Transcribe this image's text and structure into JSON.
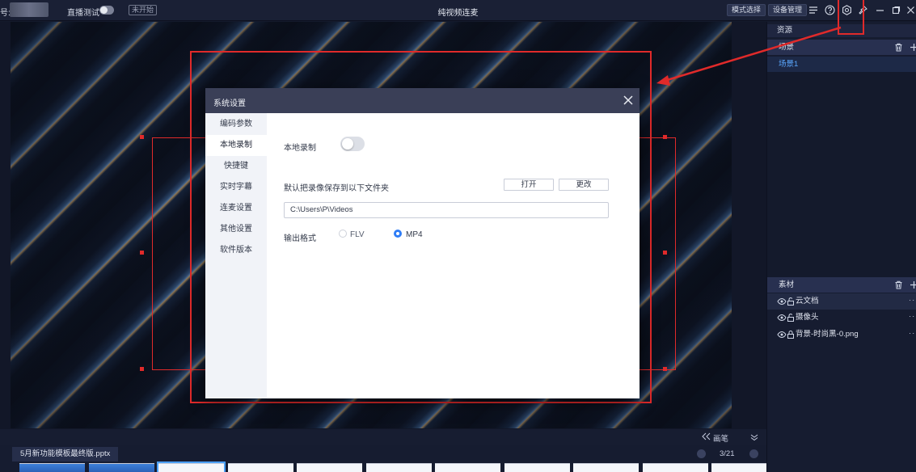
{
  "topbar": {
    "account_prefix": "号:",
    "live_test_label": "直播测试",
    "status_badge": "未开始",
    "title": "纯视频连麦",
    "mode_select_btn": "模式选择",
    "device_manage_btn": "设备管理",
    "icons": [
      "menu-icon",
      "help-icon",
      "settings-gear-icon",
      "pin-icon",
      "minimize-icon",
      "maximize-icon",
      "close-icon"
    ]
  },
  "dialog": {
    "title": "系统设置",
    "nav": [
      {
        "label": "编码参数",
        "active": false
      },
      {
        "label": "本地录制",
        "active": true
      },
      {
        "label": "快捷键",
        "active": false
      },
      {
        "label": "实时字幕",
        "active": false
      },
      {
        "label": "连麦设置",
        "active": false
      },
      {
        "label": "其他设置",
        "active": false
      },
      {
        "label": "软件版本",
        "active": false
      }
    ],
    "local_record_label": "本地录制",
    "local_record_enabled": false,
    "save_folder_label": "默认把录像保存到以下文件夹",
    "open_btn": "打开",
    "change_btn": "更改",
    "save_path": "C:\\Users\\P\\Videos",
    "format_label": "输出格式",
    "formats": [
      {
        "label": "FLV",
        "selected": false
      },
      {
        "label": "MP4",
        "selected": true
      }
    ]
  },
  "right_panel": {
    "resources_label": "资源",
    "scenes_label": "场景",
    "scenes": [
      "场景1"
    ],
    "materials_label": "素材",
    "materials": [
      {
        "name": "云文档",
        "visible": true,
        "locked": false
      },
      {
        "name": "摄像头",
        "visible": true,
        "locked": false
      },
      {
        "name": "背景-时尚黑-0.png",
        "visible": true,
        "locked": true
      }
    ]
  },
  "bottom": {
    "canvas_label": "画笔",
    "file_tab": "5月新功能模板最终版.pptx",
    "page_indicator": "3/21"
  },
  "colors": {
    "accent_red": "#e02a2a",
    "accent_blue": "#2f7df6",
    "scene_active_text": "#5aa7ff"
  }
}
